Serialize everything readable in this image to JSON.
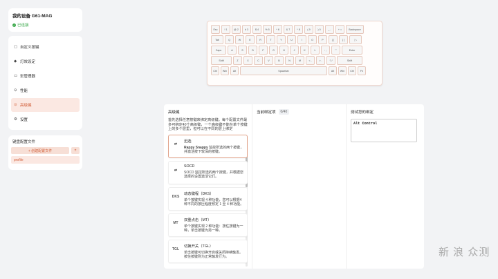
{
  "device": {
    "name": "我的设备 G61-MAG",
    "status": "已连接"
  },
  "nav": [
    {
      "label": "自定义按键",
      "icon": "▢"
    },
    {
      "label": "灯效设定",
      "icon": "◆"
    },
    {
      "label": "宏管理器",
      "icon": "▭"
    },
    {
      "label": "性能",
      "icon": "⊙"
    },
    {
      "label": "高级键",
      "icon": "⊙"
    },
    {
      "label": "设置",
      "icon": "⚙"
    }
  ],
  "profiles": {
    "title": "键盘配置文件",
    "create_label": "+ 创建配置文件",
    "import_label": "±",
    "items": [
      "profile"
    ]
  },
  "keyboard": {
    "rows": [
      [
        "Esc",
        "! 1",
        "@ 2",
        "# 3",
        "$ 4",
        "% 5",
        "^ 6",
        "& 7",
        "* 8",
        "( 9",
        ") 0",
        "_ -",
        "+ =",
        "Backspace"
      ],
      [
        "Tab",
        "Q",
        "W",
        "E",
        "R",
        "T",
        "Y",
        "U",
        "I",
        "O",
        "P",
        "{ [",
        "} ]",
        "| \\"
      ],
      [
        "Caps",
        "A",
        "S",
        "D",
        "F",
        "G",
        "H",
        "J",
        "K",
        "L",
        ": ;",
        "\" '",
        "Enter"
      ],
      [
        "Shift",
        "Z",
        "X",
        "C",
        "V",
        "B",
        "N",
        "M",
        "< ,",
        "> .",
        "? /",
        "Shift"
      ],
      [
        "Ctrl",
        "Win",
        "Alt",
        "Spacebar",
        "Alt",
        "Win",
        "Ctrl",
        "Fn"
      ]
    ]
  },
  "advanced": {
    "title": "高级键",
    "description": "首先选择任意按键来绑定高级键。每个配置文件最多可绑定40个高级键，一个高级键不能在单个按键上的多个层里，但可以在不同的层上绑定",
    "options": [
      {
        "icon": "⇄",
        "name": "迅选",
        "desc_bold": "Rappy Snappy",
        "desc": " 监控所选的两个按键，并激活按下较深的按键。"
      },
      {
        "icon": "⇄",
        "name": "SOCD",
        "desc_bold": "",
        "desc": "SOCD 监控所选的两个按键，并根据您选择的设置激活它们。"
      },
      {
        "icon": "DKS",
        "name": "动态键程（DKS）",
        "desc_bold": "",
        "desc": "单个按键实现 4 种功能，您可以根据4种不同的按压程度预定 1 至 4 种功能。"
      },
      {
        "icon": "MT",
        "name": "双重点击（MT）",
        "desc_bold": "",
        "desc": "单个按键实现 2 种功能：按住按键为一种，单击按键为另一种。"
      },
      {
        "icon": "TGL",
        "name": "切换开关（TGL）",
        "desc_bold": "",
        "desc": "单击按键可切换开启或关闭持续触发。按住按键则为正常触发行为。"
      }
    ]
  },
  "bound": {
    "title": "当前绑定项",
    "count": "0/40"
  },
  "test": {
    "title": "测试您的绑定",
    "value": "Alt Control"
  },
  "watermark": "新 浪 众测"
}
